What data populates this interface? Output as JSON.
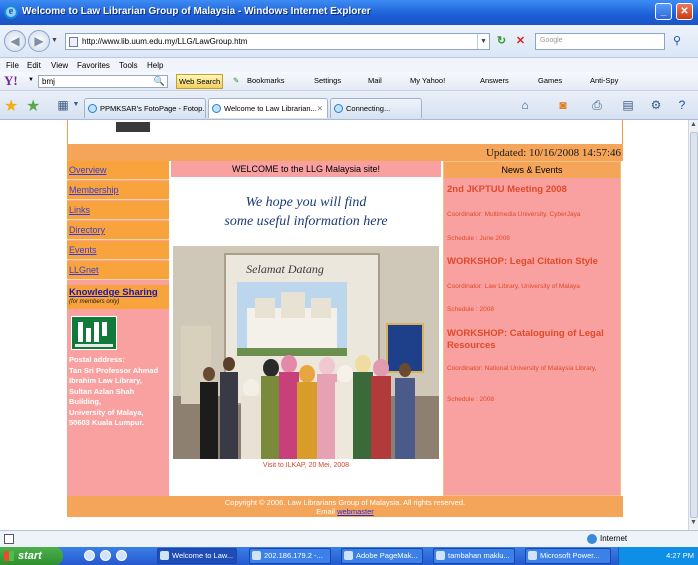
{
  "window": {
    "title": "Welcome to Law Librarian Group of Malaysia - Windows Internet Explorer",
    "minimize": "_",
    "maximize": "□",
    "close": "✕"
  },
  "address_bar": {
    "url": "http://www.lib.uum.edu.my/LLG/LawGroup.htm",
    "search_placeholder": "Google"
  },
  "menu": [
    "File",
    "Edit",
    "View",
    "Favorites",
    "Tools",
    "Help"
  ],
  "yahoo_toolbar": {
    "search_value": "bmj",
    "search_button": "Web Search",
    "bookmarks": "Bookmarks",
    "settings": "Settings",
    "mail": "Mail",
    "my_yahoo": "My Yahoo!",
    "answers": "Answers",
    "games": "Games",
    "anti_spy": "Anti-Spy"
  },
  "tabs": [
    {
      "label": "PPMKSAR's FotoPage - Fotop...",
      "active": false
    },
    {
      "label": "Welcome to Law Librarian...",
      "active": true
    },
    {
      "label": "Connecting...",
      "active": false
    }
  ],
  "page": {
    "updated": "Updated: 10/16/2008 14:57:46",
    "nav": [
      "Overview",
      "Membership",
      "Links",
      "Directory",
      "Events",
      "LLGnet"
    ],
    "knowledge_sharing": "Knowledge Sharing",
    "members_only": "(for members only)",
    "postal_lines": [
      "Postal address:",
      "Tan Sri Professor Ahmad",
      "Ibrahim Law Library,",
      "Sultan Azlan Shah",
      "Building,",
      "University of Malaya,",
      "50603 Kuala Lumpur."
    ],
    "welcome": "WELCOME to the LLG Malaysia site!",
    "hope_line1": "We hope you will find",
    "hope_line2": "some useful information here",
    "banner": "Selamat Datang",
    "photo_caption": "Visit to ILKAP, 20 Mei, 2008",
    "news_heading": "News & Events",
    "news": [
      {
        "title": "2nd JKPTUU Meeting 2008",
        "coordinator": "Coordinator: Multimedia University, CyberJaya",
        "schedule": "Schedule : June 2008"
      },
      {
        "title": "WORKSHOP: Legal Citation Style",
        "coordinator": "Coordinator: Law Library, University of Malaya",
        "schedule": "Schedule : 2008"
      },
      {
        "title": "WORKSHOP: Cataloguing of Legal Resources",
        "coordinator": "Coordinator: National University of Malaysia Library,",
        "schedule": "Schedule : 2008"
      }
    ],
    "footer_copyright": "Copyright © 2006. Law Librarians Group of Malaysia. All rights reserved.",
    "footer_email_label": "Email",
    "footer_webmaster": "webmaster"
  },
  "status": {
    "zone": "Internet"
  },
  "taskbar": {
    "start": "start",
    "tasks": [
      "Welcome to Law...",
      "202.186.179.2 -...",
      "Adobe PageMak...",
      "tambahan maklu...",
      "Microsoft Power..."
    ],
    "clock": "4:27 PM"
  }
}
